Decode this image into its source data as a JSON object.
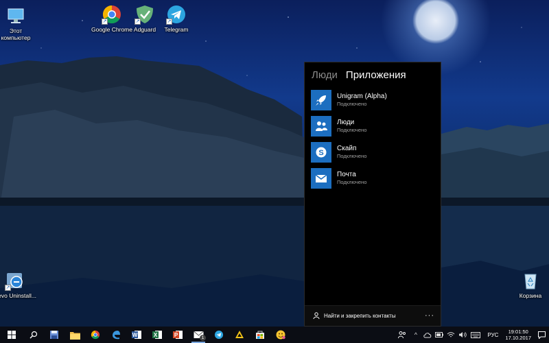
{
  "desktop": {
    "icons_left": [
      {
        "label": "Этот компьютер",
        "icon": "this-pc-icon"
      },
      {
        "label": "Revo Uninstall...",
        "icon": "revo-uninstaller-icon"
      }
    ],
    "icons_top": [
      {
        "label": "Google Chrome",
        "icon": "chrome-icon"
      },
      {
        "label": "Adguard",
        "icon": "adguard-icon"
      },
      {
        "label": "Telegram",
        "icon": "telegram-icon"
      }
    ],
    "recycle_bin": {
      "label": "Корзина",
      "icon": "recycle-bin-icon"
    }
  },
  "people_flyout": {
    "tabs": [
      {
        "label": "Люди",
        "active": false
      },
      {
        "label": "Приложения",
        "active": true
      }
    ],
    "apps": [
      {
        "name": "Unigram (Alpha)",
        "status": "Подключено",
        "icon": "rocket-icon"
      },
      {
        "name": "Люди",
        "status": "Подключено",
        "icon": "people-icon"
      },
      {
        "name": "Скайп",
        "status": "Подключено",
        "icon": "skype-icon"
      },
      {
        "name": "Почта",
        "status": "Подключено",
        "icon": "mail-icon"
      }
    ],
    "footer_label": "Найти и закрепить контакты",
    "more_label": "···"
  },
  "taskbar": {
    "pinned": [
      "start-icon",
      "search-icon",
      "save-icon",
      "file-explorer-icon",
      "chrome-icon",
      "edge-icon",
      "word-icon",
      "excel-icon",
      "powerpoint-icon",
      "mail-icon",
      "telegram-icon",
      "adguard-icon",
      "store-icon",
      "emoji-icon"
    ],
    "mail_badge": "1",
    "language": "РУС",
    "time": "19:01:50",
    "date": "17.10.2017"
  },
  "colors": {
    "accent": "#1c6ec0",
    "flyout_bg": "#000000",
    "taskbar_bg": "#0b0d14"
  }
}
